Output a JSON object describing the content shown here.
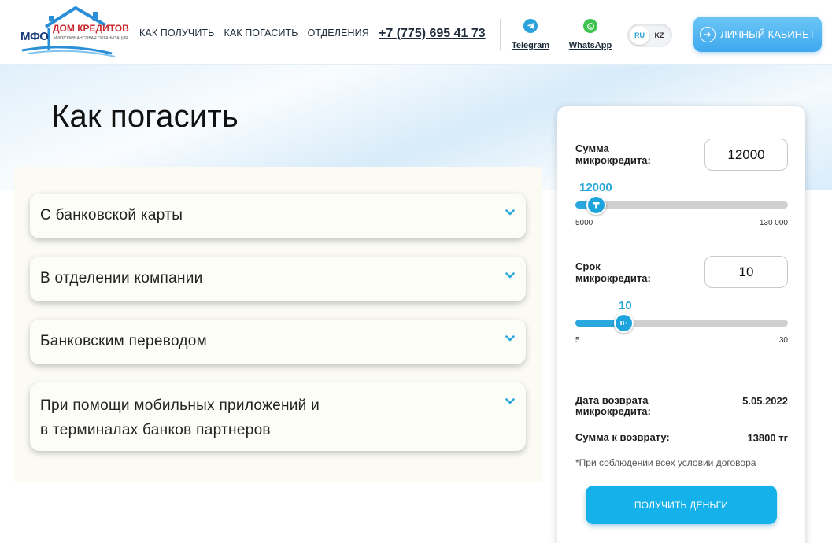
{
  "logo": {
    "mfo": "МФО",
    "name": "ДОМ КРЕДИТОВ",
    "subtitle": "МИКРОФИНАНСОВАЯ ОРГАНИЗАЦИЯ"
  },
  "nav": {
    "items": [
      "КАК ПОЛУЧИТЬ",
      "КАК ПОГАСИТЬ",
      "ОТДЕЛЕНИЯ"
    ]
  },
  "phone": "+7 (775) 695 41 73",
  "social": {
    "telegram": "Telegram",
    "whatsapp": "WhatsApp"
  },
  "lang": {
    "ru": "RU",
    "kz": "KZ",
    "active": "RU"
  },
  "cabinet_label": "ЛИЧНЫЙ КАБИНЕТ",
  "page_title": "Как погасить",
  "accordion": [
    {
      "line1": "С банковской карты",
      "line2": ""
    },
    {
      "line1": "В отделении компании",
      "line2": ""
    },
    {
      "line1": "Банковским переводом",
      "line2": ""
    },
    {
      "line1": "При помощи мобильных приложений и",
      "line2": "в терминалах банков партнеров"
    }
  ],
  "calculator": {
    "amount": {
      "label_line1": "Сумма",
      "label_line2": "микрокредита:",
      "value": "12000",
      "bubble": "12000",
      "min_label": "5000",
      "max_label": "130 000",
      "min": 5000,
      "max": 130000,
      "current": 12000
    },
    "term": {
      "label_line1": "Срок",
      "label_line2": "микрокредита:",
      "value": "10",
      "bubble": "10",
      "min_label": "5",
      "max_label": "30",
      "min": 5,
      "max": 30,
      "current": 10
    },
    "return_date_label_line1": "Дата возврата",
    "return_date_label_line2": "микрокредита:",
    "return_date": "5.05.2022",
    "return_sum_label": "Сумма к возврату:",
    "return_sum": "13800 тг",
    "note": "*При соблюдении всех условии договора",
    "cta": "ПОЛУЧИТЬ ДЕНЬГИ"
  },
  "colors": {
    "accent": "#1ea4dd",
    "cta": "#15b1ea",
    "logo_red": "#c8262b",
    "logo_blue": "#1d3d7a"
  }
}
